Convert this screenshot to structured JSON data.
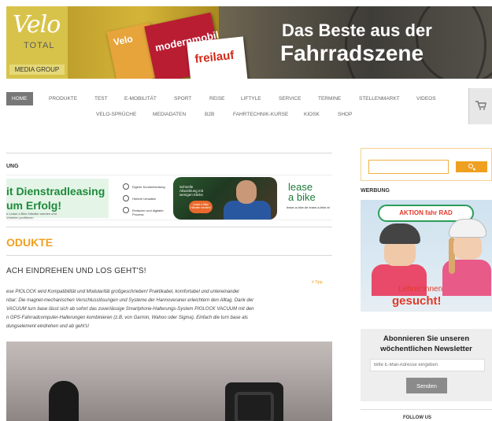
{
  "header": {
    "logo": {
      "brand": "Velo",
      "sub": "TOTAL",
      "group": "MEDIA GROUP"
    },
    "magazines": [
      "Velo",
      "modernmobil",
      "freilauf"
    ],
    "slogan_line1": "Das Beste aus der",
    "slogan_line2": "Fahrradszene"
  },
  "nav": {
    "row1": [
      "HOME",
      "PRODUKTE",
      "TEST",
      "E-MOBILITÄT",
      "SPORT",
      "REISE",
      "LIFTYLE",
      "SERVICE",
      "TERMINE",
      "STELLENMARKT",
      "VIDEOS"
    ],
    "row2": [
      "VELO-SPRÜCHE",
      "MEDIADATEN",
      "B2B",
      "FAHRTECHNIK-KURSE",
      "KIOSK",
      "SHOP"
    ],
    "active": "HOME",
    "cart_icon": "cart-icon"
  },
  "main": {
    "ad_label": "UNG",
    "ad": {
      "headline1": "it Dienstradleasing",
      "headline2": "um Erfolg!",
      "small1": "e Lease a Bike-Händler werden und",
      "small2": "Vorteilen profitieren",
      "features": [
        "Eigene Kundenbindung",
        "Höhere Umsätze",
        "Einfacher und digitaler Prozess"
      ],
      "photo_text": "Schnelle Abwicklung mit wenigen Klicks",
      "photo_tag": "Lease a Bike Händler werden!",
      "brand_line1": "lease",
      "brand_line2": "a bike",
      "brand_small": "lease-a-bike.de lease-a-bike.at"
    },
    "section_title": "ODUKTE",
    "article": {
      "title": "ACH EINDREHEN UND LOS GEHT'S!",
      "tag": "# Tipp",
      "body": [
        "ese PIOLOCK wird Kompatibilität und Modularität großgeschrieben! Praktikabel, komfortabel und untereinander",
        "nbar: Die magnet-mechanischen Verschlusslösungen und Systeme der Hannoveraner erleichtern den Alltag. Dank der",
        "VACUUM turn base lässt sich ab sofort das zuverlässige Smartphone-Halterungs-System PIOLOCK VACUUM mit den",
        "n GPS-Fahrradcomputer-Halterungen kombinieren (z.B. von Garmin, Wahoo oder Sigma). Einfach die turn base als",
        "dungselement eindrehen und ab geht's!"
      ]
    }
  },
  "sidebar": {
    "search_placeholder": "",
    "search_icon": "search-icon",
    "ad_label": "WERBUNG",
    "ad": {
      "badge": "AKTION fahr RAD",
      "text1": "Lehrer:innen",
      "text2": "gesucht!"
    },
    "newsletter": {
      "title_line1": "Abonnieren Sie unseren",
      "title_line2": "wöchentlichen Newsletter",
      "placeholder": "Bitte E-Mail-Adresse eingeben",
      "button": "Senden"
    },
    "bottom_label": "FOLLOW US"
  }
}
